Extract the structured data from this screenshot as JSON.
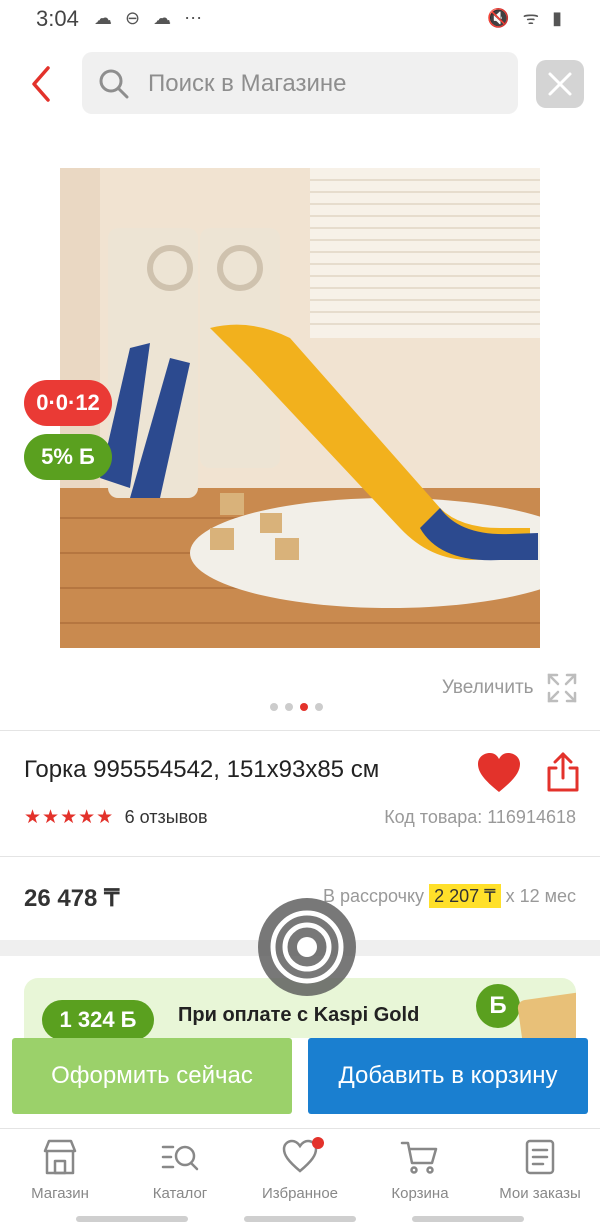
{
  "status_bar": {
    "time": "3:04",
    "left_icons": "☁ ⊖ ☁ ⋯",
    "right_icons": "🔇 ᯤ ▮"
  },
  "search": {
    "placeholder": "Поиск в Магазине"
  },
  "product": {
    "badge_installment": "0·0·12",
    "badge_bonus": "5% Б",
    "zoom_label": "Увеличить",
    "gallery_total": 4,
    "gallery_active": 3,
    "title": "Горка 995554542, 151х93х85 см",
    "stars": "★★★★★",
    "reviews": "6 отзывов",
    "sku": "Код товара: 116914618",
    "price": "26 478 ₸",
    "installment_prefix": "В рассрочку",
    "installment_amount": "2 207 ₸",
    "installment_suffix": "х 12 мес"
  },
  "gold_banner": {
    "bonus": "1 324 Б",
    "text": "При оплате с Kaspi Gold",
    "coin": "Б"
  },
  "actions": {
    "checkout": "Оформить сейчас",
    "add_to_cart": "Добавить в корзину"
  },
  "nav": {
    "shop": "Магазин",
    "catalog": "Каталог",
    "favorites": "Избранное",
    "cart": "Корзина",
    "orders": "Мои заказы"
  },
  "colors": {
    "accent_red": "#e3322b",
    "bonus_green": "#5aa01f",
    "cart_blue": "#1a7fd0",
    "checkout_green": "#9bd16a",
    "installment_yellow": "#ffe02a"
  }
}
